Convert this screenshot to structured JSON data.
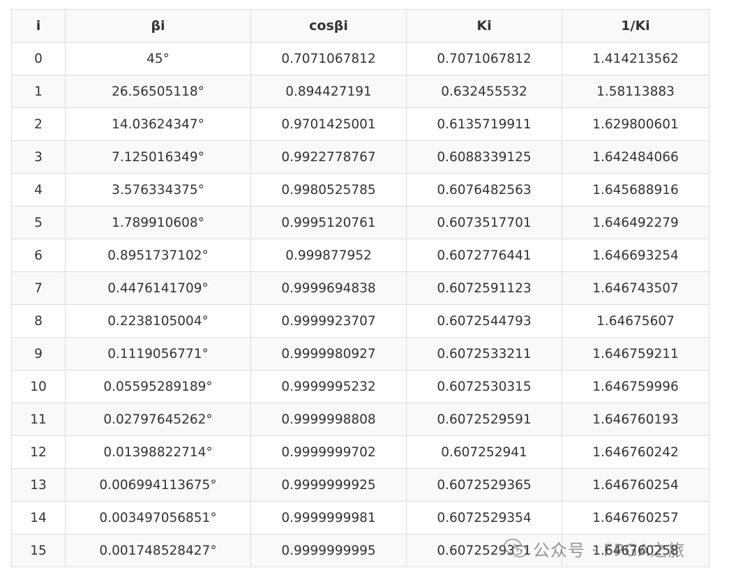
{
  "table": {
    "headers": [
      "i",
      "βi",
      "cosβi",
      "Ki",
      "1/Ki"
    ],
    "rows": [
      [
        "0",
        "45°",
        "0.7071067812",
        "0.7071067812",
        "1.414213562"
      ],
      [
        "1",
        "26.56505118°",
        "0.894427191",
        "0.632455532",
        "1.58113883"
      ],
      [
        "2",
        "14.03624347°",
        "0.9701425001",
        "0.6135719911",
        "1.629800601"
      ],
      [
        "3",
        "7.125016349°",
        "0.9922778767",
        "0.6088339125",
        "1.642484066"
      ],
      [
        "4",
        "3.576334375°",
        "0.9980525785",
        "0.6076482563",
        "1.645688916"
      ],
      [
        "5",
        "1.789910608°",
        "0.9995120761",
        "0.6073517701",
        "1.646492279"
      ],
      [
        "6",
        "0.8951737102°",
        "0.999877952",
        "0.6072776441",
        "1.646693254"
      ],
      [
        "7",
        "0.4476141709°",
        "0.9999694838",
        "0.6072591123",
        "1.646743507"
      ],
      [
        "8",
        "0.2238105004°",
        "0.9999923707",
        "0.6072544793",
        "1.64675607"
      ],
      [
        "9",
        "0.1119056771°",
        "0.9999980927",
        "0.6072533211",
        "1.646759211"
      ],
      [
        "10",
        "0.05595289189°",
        "0.9999995232",
        "0.6072530315",
        "1.646759996"
      ],
      [
        "11",
        "0.02797645262°",
        "0.9999998808",
        "0.6072529591",
        "1.646760193"
      ],
      [
        "12",
        "0.01398822714°",
        "0.9999999702",
        "0.607252941",
        "1.646760242"
      ],
      [
        "13",
        "0.006994113675°",
        "0.9999999925",
        "0.6072529365",
        "1.646760254"
      ],
      [
        "14",
        "0.003497056851°",
        "0.9999999981",
        "0.6072529354",
        "1.646760257"
      ],
      [
        "15",
        "0.001748528427°",
        "0.9999999995",
        "0.6072529351",
        "1.646760258"
      ]
    ]
  },
  "watermark": {
    "icon": "wechat-icon",
    "text": "公众号 · FPGA之旅"
  }
}
